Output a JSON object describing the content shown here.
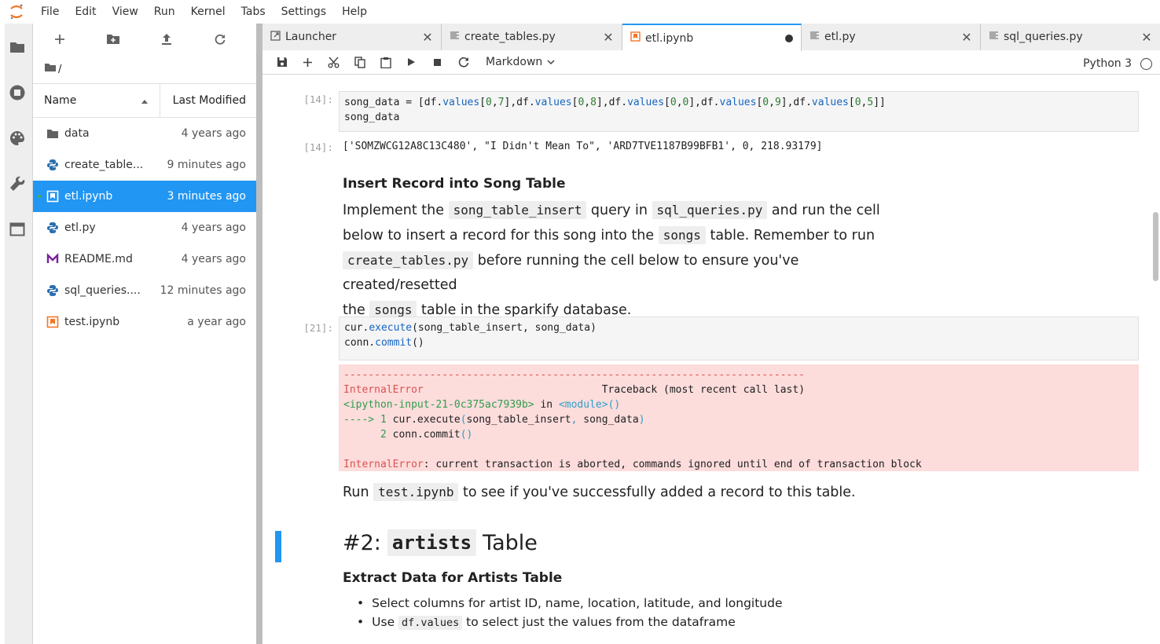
{
  "menubar": {
    "items": [
      "File",
      "Edit",
      "View",
      "Run",
      "Kernel",
      "Tabs",
      "Settings",
      "Help"
    ]
  },
  "filebrowser": {
    "path": "/",
    "header": {
      "name": "Name",
      "modified": "Last Modified"
    },
    "files": [
      {
        "name": "data",
        "modified": "4 years ago",
        "icon": "folder-icon"
      },
      {
        "name": "create_table...",
        "modified": "9 minutes ago",
        "icon": "python-icon"
      },
      {
        "name": "etl.ipynb",
        "modified": "3 minutes ago",
        "icon": "notebook-icon",
        "selected": true
      },
      {
        "name": "etl.py",
        "modified": "4 years ago",
        "icon": "python-icon"
      },
      {
        "name": "README.md",
        "modified": "4 years ago",
        "icon": "markdown-icon"
      },
      {
        "name": "sql_queries....",
        "modified": "12 minutes ago",
        "icon": "python-icon"
      },
      {
        "name": "test.ipynb",
        "modified": "a year ago",
        "icon": "notebook-icon"
      }
    ]
  },
  "tabs": [
    {
      "label": "Launcher",
      "icon": "launcher-icon"
    },
    {
      "label": "create_tables.py",
      "icon": "text-file-icon"
    },
    {
      "label": "etl.ipynb",
      "icon": "notebook-icon",
      "active": true,
      "dirty": true
    },
    {
      "label": "etl.py",
      "icon": "text-file-icon"
    },
    {
      "label": "sql_queries.py",
      "icon": "text-file-icon"
    }
  ],
  "notebook_toolbar": {
    "cell_type": "Markdown",
    "kernel": "Python 3"
  },
  "cells": {
    "c14": {
      "in_prompt": "[14]:",
      "out_prompt": "[14]:",
      "output": "['SOMZWCG12A8C13C480', \"I Didn't Mean To\", 'ARD7TVE1187B99BFB1', 0, 218.93179]"
    },
    "md1": {
      "heading": "Insert Record into Song Table",
      "p1a": "Implement the ",
      "code1": "song_table_insert",
      "p1b": " query in ",
      "code2": "sql_queries.py",
      "p1c": " and run the cell",
      "p2a": "below to insert a record for this song into the ",
      "code3": "songs",
      "p2b": " table. Remember to run",
      "code4": "create_tables.py",
      "p3a": " before running the cell below to ensure you've created/resetted",
      "p4a": "the ",
      "code5": "songs",
      "p4b": " table in the sparkify database."
    },
    "c21": {
      "in_prompt": "[21]:",
      "err_dashes": "---------------------------------------------------------------------------",
      "err_name": "InternalError",
      "err_traceback": "Traceback (most recent call last)",
      "err_input": "<ipython-input-21-0c375ac7939b>",
      "err_in": " in ",
      "err_module": "<module>",
      "err_paren": "()",
      "err_arrow": "----> 1",
      "err_line1a": " cur.execute",
      "err_line1b": "(",
      "err_line1c": "song_table_insert",
      "err_line1d": ", ",
      "err_line1e": "song_data",
      "err_line1f": ")",
      "err_ln2": "      2",
      "err_line2a": " conn.commit",
      "err_line2b": "()",
      "err_final_name": "InternalError",
      "err_final_msg": ": current transaction is aborted, commands ignored until end of transaction block"
    },
    "md2": {
      "p_a": "Run ",
      "code": "test.ipynb",
      "p_b": " to see if you've successfully added a record to this table."
    },
    "md3": {
      "h1_a": "#2: ",
      "h1_code": "artists",
      "h1_b": " Table",
      "h3": "Extract Data for Artists Table",
      "li1": "Select columns for artist ID, name, location, latitude, and longitude",
      "li2a": "Use ",
      "li2code": "df.values",
      "li2b": " to select just the values from the dataframe"
    }
  }
}
